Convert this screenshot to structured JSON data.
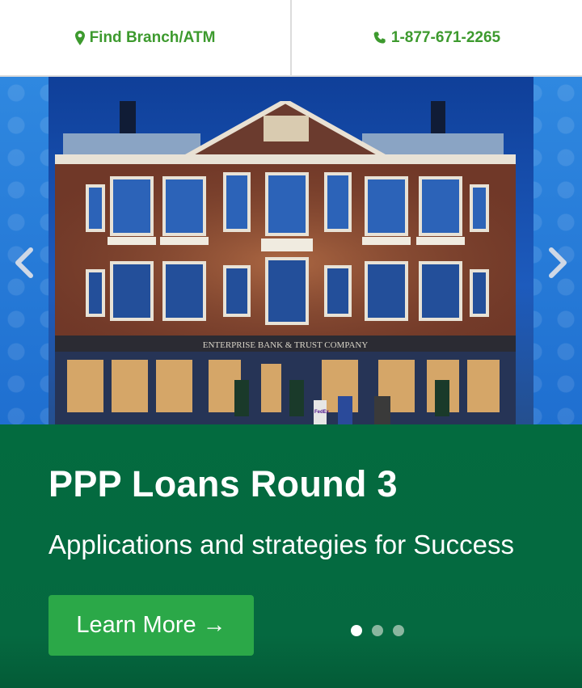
{
  "topbar": {
    "branch_label": "Find Branch/ATM",
    "branch_icon": "map-marker-icon",
    "phone_label": "1-877-671-2265",
    "phone_icon": "phone-icon",
    "accent_color": "#3d9a2e"
  },
  "hero": {
    "facade_sign": "ENTERPRISE BANK & TRUST COMPANY",
    "delivery_mark": "FedEx",
    "prev_icon": "chevron-left-icon",
    "next_icon": "chevron-right-icon"
  },
  "promo": {
    "title": "PPP Loans Round 3",
    "subtitle": "Applications and strategies for Success",
    "cta_label": "Learn More →",
    "background_color": "#036b3f",
    "button_color": "#2ba848",
    "slides_total": 3,
    "slide_active": 1
  }
}
